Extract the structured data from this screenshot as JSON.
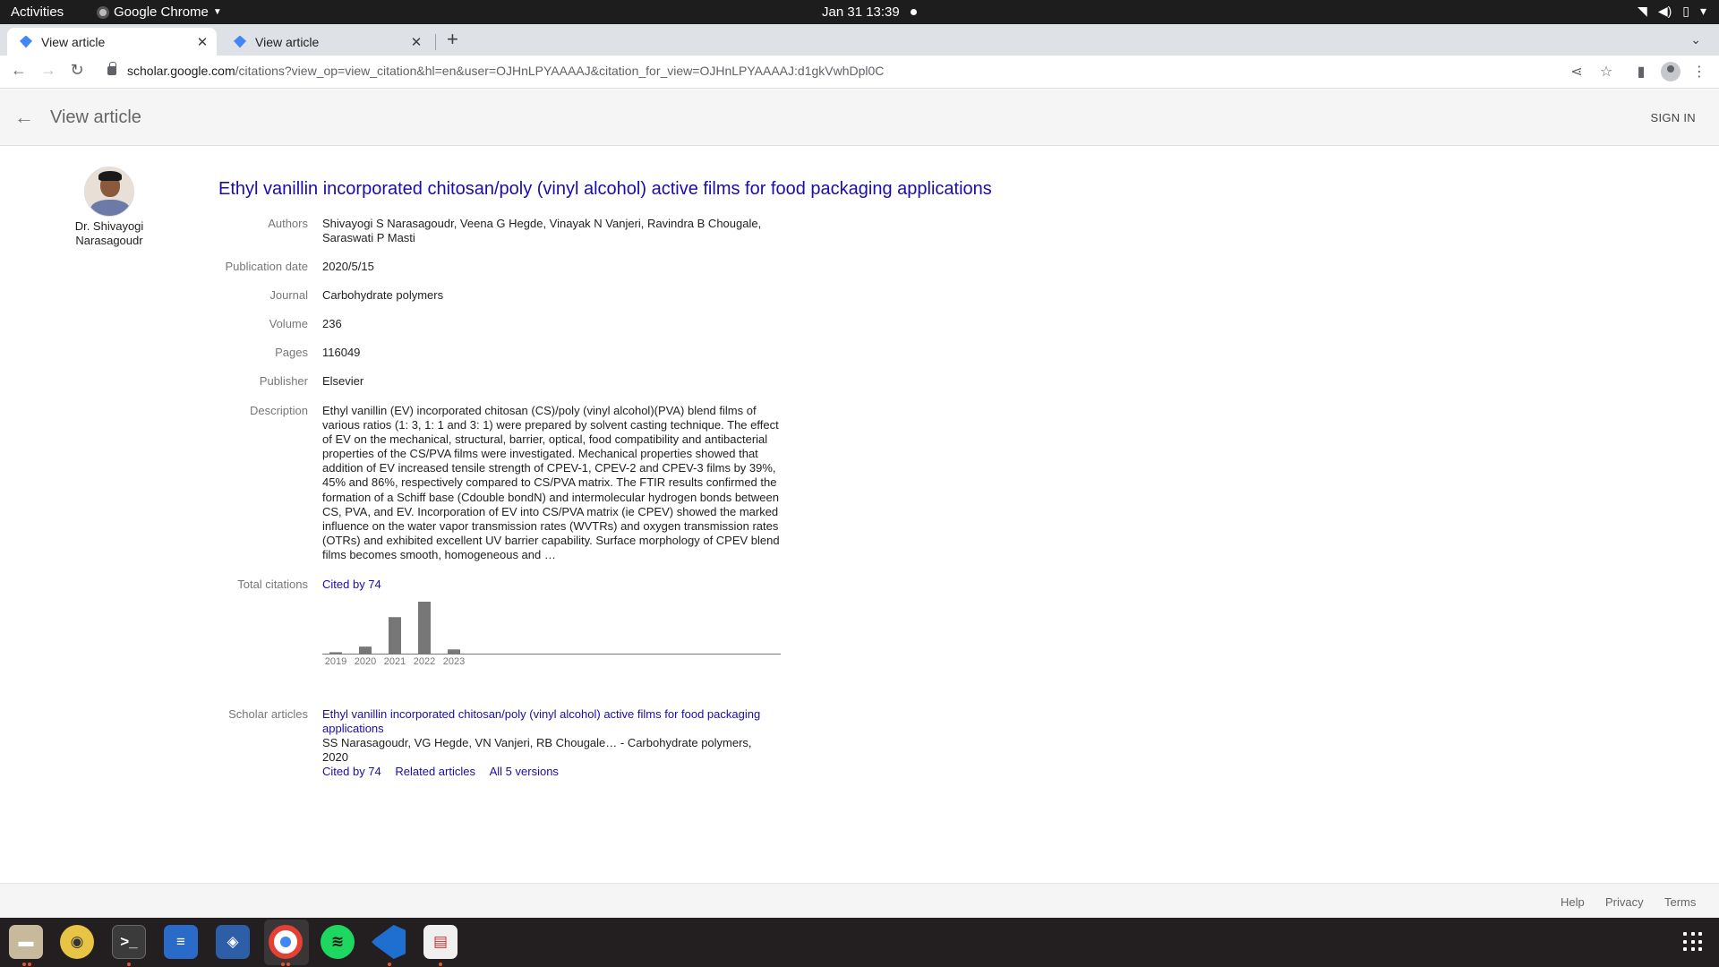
{
  "system": {
    "activities": "Activities",
    "app_name": "Google Chrome",
    "clock": "Jan 31  13:39"
  },
  "browser": {
    "tabs": [
      {
        "title": "View article",
        "active": true
      },
      {
        "title": "View article",
        "active": false
      }
    ],
    "url_host": "scholar.google.com",
    "url_rest": "/citations?view_op=view_citation&hl=en&user=OJHnLPYAAAAJ&citation_for_view=OJHnLPYAAAAJ:d1gkVwhDpl0C"
  },
  "header": {
    "title": "View article",
    "sign_in": "SIGN IN"
  },
  "profile": {
    "name": "Dr. Shivayogi Narasagoudr"
  },
  "article": {
    "title": "Ethyl vanillin incorporated chitosan/poly (vinyl alcohol) active films for food packaging applications",
    "fields": {
      "authors": {
        "label": "Authors",
        "value": "Shivayogi S Narasagoudr, Veena G Hegde, Vinayak N Vanjeri, Ravindra B Chougale, Saraswati P Masti"
      },
      "publication_date": {
        "label": "Publication date",
        "value": "2020/5/15"
      },
      "journal": {
        "label": "Journal",
        "value": "Carbohydrate polymers"
      },
      "volume": {
        "label": "Volume",
        "value": "236"
      },
      "pages": {
        "label": "Pages",
        "value": "116049"
      },
      "publisher": {
        "label": "Publisher",
        "value": "Elsevier"
      },
      "description": {
        "label": "Description",
        "value": "Ethyl vanillin (EV) incorporated chitosan (CS)/poly (vinyl alcohol)(PVA) blend films of various ratios (1: 3, 1: 1 and 3: 1) were prepared by solvent casting technique. The effect of EV on the mechanical, structural, barrier, optical, food compatibility and antibacterial properties of the CS/PVA films were investigated. Mechanical properties showed that addition of EV increased tensile strength of CPEV-1, CPEV-2 and CPEV-3 films by 39%, 45% and 86%, respectively compared to CS/PVA matrix. The FTIR results confirmed the formation of a Schiff base (Cdouble bondN) and intermolecular hydrogen bonds between CS, PVA, and EV. Incorporation of EV into CS/PVA matrix (ie CPEV) showed the marked influence on the water vapor transmission rates (WVTRs) and oxygen transmission rates (OTRs) and exhibited excellent UV barrier capability. Surface morphology of CPEV blend films becomes smooth, homogeneous and …"
      },
      "total_citations": {
        "label": "Total citations",
        "value": "Cited by 74"
      },
      "scholar_articles": {
        "label": "Scholar articles",
        "title": "Ethyl vanillin incorporated chitosan/poly (vinyl alcohol) active films for food packaging applications",
        "meta": "SS Narasagoudr, VG Hegde, VN Vanjeri, RB Chougale… - Carbohydrate polymers, 2020",
        "links": {
          "cited_by": "Cited by 74",
          "related": "Related articles",
          "versions": "All 5 versions"
        }
      }
    }
  },
  "chart_data": {
    "type": "bar",
    "categories": [
      "2019",
      "2020",
      "2021",
      "2022",
      "2023"
    ],
    "values": [
      1,
      5,
      26,
      37,
      3
    ],
    "ylim": [
      0,
      37
    ],
    "grid": false,
    "bar_color": "#777777"
  },
  "footer": {
    "help": "Help",
    "privacy": "Privacy",
    "terms": "Terms"
  },
  "dock": {
    "apps": [
      "files-icon",
      "rhythmbox-icon",
      "terminal-icon",
      "text-editor-icon",
      "virtualbox-icon",
      "chrome-icon",
      "spotify-icon",
      "vscode-icon",
      "document-viewer-icon"
    ]
  },
  "colors": {
    "link": "#1a0dab",
    "ubuntu_accent": "#e95420"
  }
}
